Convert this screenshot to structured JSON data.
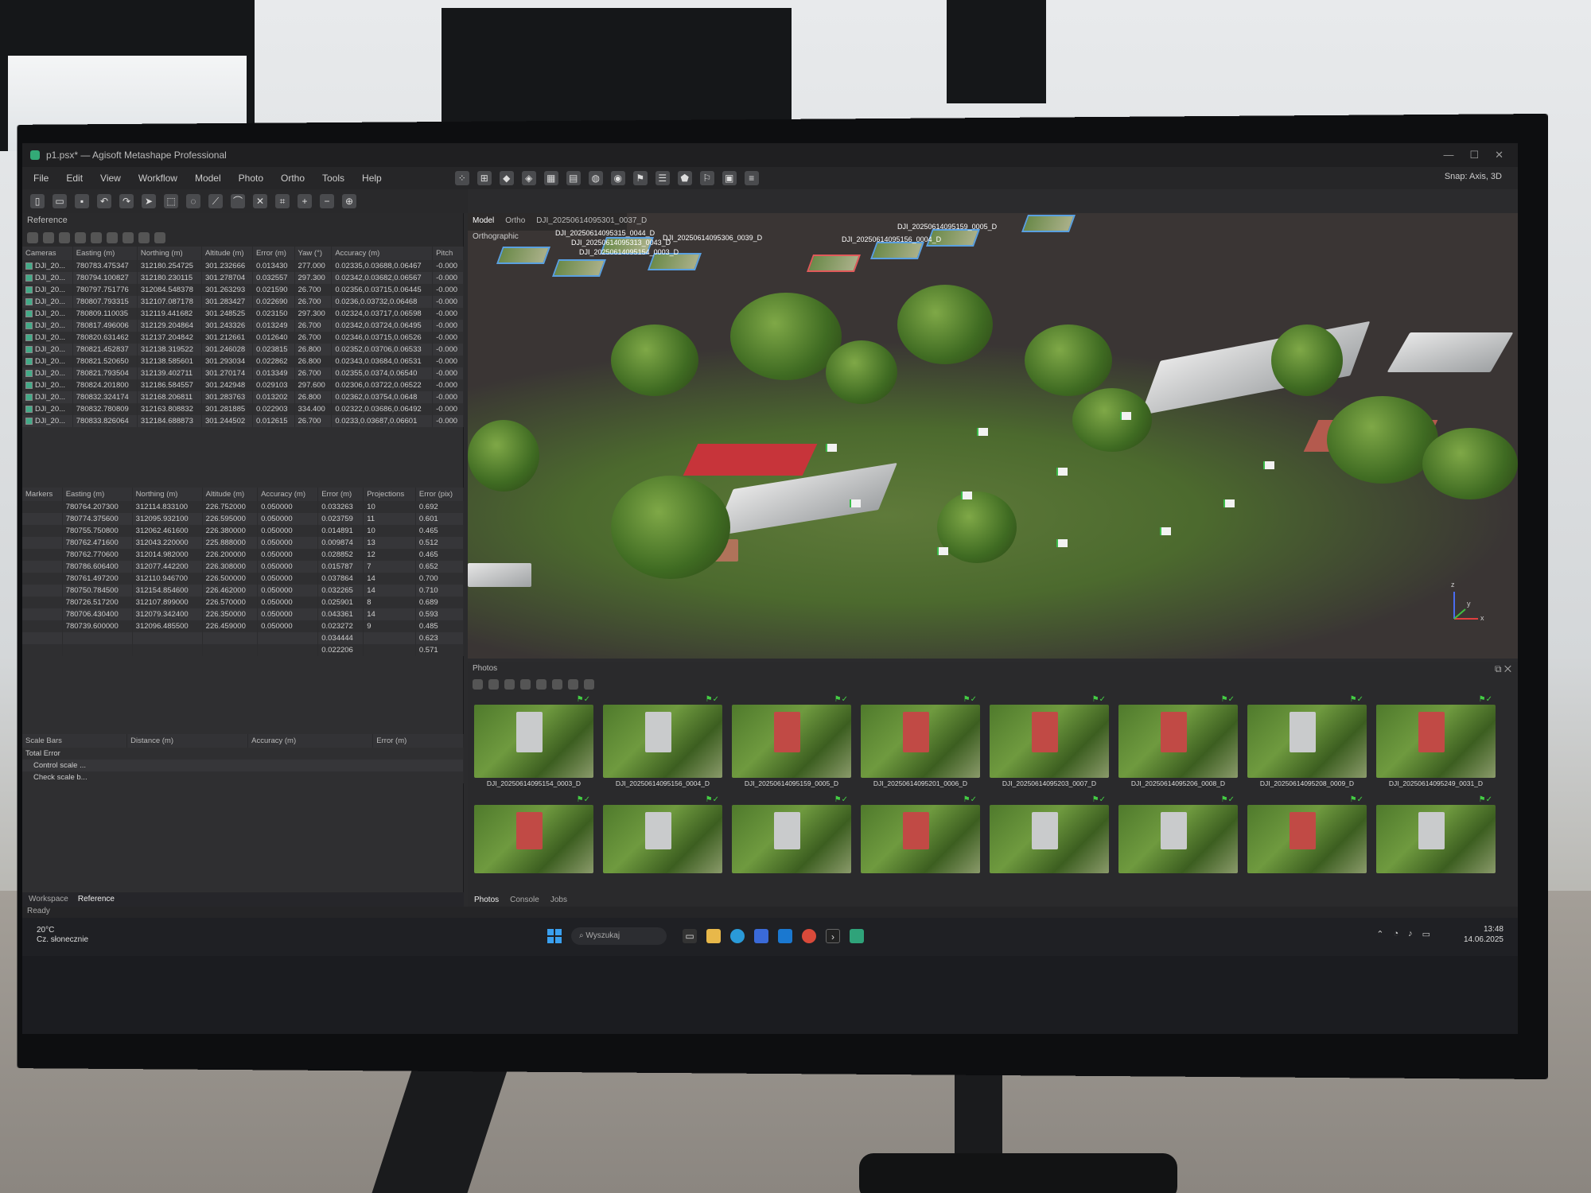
{
  "window": {
    "title": "p1.psx* — Agisoft Metashape Professional",
    "controls": [
      "—",
      "☐",
      "✕"
    ]
  },
  "menu": [
    "File",
    "Edit",
    "View",
    "Workflow",
    "Model",
    "Photo",
    "Ortho",
    "Tools",
    "Help"
  ],
  "viewport": {
    "snap": "Snap: Axis, 3D",
    "tabs": [
      "Model",
      "Ortho",
      "DJI_20250614095301_0037_D"
    ],
    "projection": "Orthographic",
    "camera_labels": [
      "DJI_20250614095159_0005_D",
      "DJI_20250614095315_0044_D",
      "DJI_20250614095313_0043_D",
      "DJI_20250614095306_0039_D",
      "DJI_20250614095156_0004_D",
      "DJI_20250614095154_0003_D"
    ],
    "axes": {
      "x": "x",
      "y": "y",
      "z": "z"
    }
  },
  "reference": {
    "panel_title": "Reference",
    "cameras_headers": [
      "Cameras",
      "Easting (m)",
      "Northing (m)",
      "Altitude (m)",
      "Error (m)",
      "Yaw (°)",
      "Accuracy (m)",
      "Pitch"
    ],
    "cameras": [
      [
        "DJI_20...",
        "780783.475347",
        "312180.254725",
        "301.232666",
        "0.013430",
        "277.000",
        "0.02335,0.03688,0.06467",
        "-0.000"
      ],
      [
        "DJI_20...",
        "780794.100827",
        "312180.230115",
        "301.278704",
        "0.032557",
        "297.300",
        "0.02342,0.03682,0.06567",
        "-0.000"
      ],
      [
        "DJI_20...",
        "780797.751776",
        "312084.548378",
        "301.263293",
        "0.021590",
        "26.700",
        "0.02356,0.03715,0.06445",
        "-0.000"
      ],
      [
        "DJI_20...",
        "780807.793315",
        "312107.087178",
        "301.283427",
        "0.022690",
        "26.700",
        "0.0236,0.03732,0.06468",
        "-0.000"
      ],
      [
        "DJI_20...",
        "780809.110035",
        "312119.441682",
        "301.248525",
        "0.023150",
        "297.300",
        "0.02324,0.03717,0.06598",
        "-0.000"
      ],
      [
        "DJI_20...",
        "780817.496006",
        "312129.204864",
        "301.243326",
        "0.013249",
        "26.700",
        "0.02342,0.03724,0.06495",
        "-0.000"
      ],
      [
        "DJI_20...",
        "780820.631462",
        "312137.204842",
        "301.212661",
        "0.012640",
        "26.700",
        "0.02346,0.03715,0.06526",
        "-0.000"
      ],
      [
        "DJI_20...",
        "780821.452837",
        "312138.319522",
        "301.246028",
        "0.023815",
        "26.800",
        "0.02352,0.03706,0.06533",
        "-0.000"
      ],
      [
        "DJI_20...",
        "780821.520650",
        "312138.585601",
        "301.293034",
        "0.022862",
        "26.800",
        "0.02343,0.03684,0.06531",
        "-0.000"
      ],
      [
        "DJI_20...",
        "780821.793504",
        "312139.402711",
        "301.270174",
        "0.013349",
        "26.700",
        "0.02355,0.0374,0.06540",
        "-0.000"
      ],
      [
        "DJI_20...",
        "780824.201800",
        "312186.584557",
        "301.242948",
        "0.029103",
        "297.600",
        "0.02306,0.03722,0.06522",
        "-0.000"
      ],
      [
        "DJI_20...",
        "780832.324174",
        "312168.206811",
        "301.283763",
        "0.013202",
        "26.800",
        "0.02362,0.03754,0.0648",
        "-0.000"
      ],
      [
        "DJI_20...",
        "780832.780809",
        "312163.808832",
        "301.281885",
        "0.022903",
        "334.400",
        "0.02322,0.03686,0.06492",
        "-0.000"
      ],
      [
        "DJI_20...",
        "780833.826064",
        "312184.688873",
        "301.244502",
        "0.012615",
        "26.700",
        "0.0233,0.03687,0.06601",
        "-0.000"
      ]
    ],
    "markers_headers": [
      "Markers",
      "Easting (m)",
      "Northing (m)",
      "Altitude (m)",
      "Accuracy (m)",
      "Error (m)",
      "Projections",
      "Error (pix)"
    ],
    "markers": [
      [
        "",
        "780764.207300",
        "312114.833100",
        "226.752000",
        "0.050000",
        "0.033263",
        "10",
        "0.692"
      ],
      [
        "",
        "780774.375600",
        "312095.932100",
        "226.595000",
        "0.050000",
        "0.023759",
        "11",
        "0.601"
      ],
      [
        "",
        "780755.750800",
        "312062.461600",
        "226.380000",
        "0.050000",
        "0.014891",
        "10",
        "0.465"
      ],
      [
        "",
        "780762.471600",
        "312043.220000",
        "225.888000",
        "0.050000",
        "0.009874",
        "13",
        "0.512"
      ],
      [
        "",
        "780762.770600",
        "312014.982000",
        "226.200000",
        "0.050000",
        "0.028852",
        "12",
        "0.465"
      ],
      [
        "",
        "780786.606400",
        "312077.442200",
        "226.308000",
        "0.050000",
        "0.015787",
        "7",
        "0.652"
      ],
      [
        "",
        "780761.497200",
        "312110.946700",
        "226.500000",
        "0.050000",
        "0.037864",
        "14",
        "0.700"
      ],
      [
        "",
        "780750.784500",
        "312154.854600",
        "226.462000",
        "0.050000",
        "0.032265",
        "14",
        "0.710"
      ],
      [
        "",
        "780726.517200",
        "312107.899000",
        "226.570000",
        "0.050000",
        "0.025901",
        "8",
        "0.689"
      ],
      [
        "",
        "780706.430400",
        "312079.342400",
        "226.350000",
        "0.050000",
        "0.043361",
        "14",
        "0.593"
      ],
      [
        "",
        "780739.600000",
        "312096.485500",
        "226.459000",
        "0.050000",
        "0.023272",
        "9",
        "0.485"
      ]
    ],
    "marker_totals": [
      [
        "",
        "",
        "",
        "",
        "",
        "0.034444",
        "",
        "0.623"
      ],
      [
        "",
        "",
        "",
        "",
        "",
        "0.022206",
        "",
        "0.571"
      ]
    ],
    "scalebar_headers": [
      "Scale Bars",
      "Distance (m)",
      "Accuracy (m)",
      "Error (m)"
    ],
    "scalebar_rows": [
      "Total Error",
      "Control scale ...",
      "Check scale b..."
    ],
    "bottom_tabs": [
      "Workspace",
      "Reference"
    ]
  },
  "status": "Ready",
  "photos": {
    "title": "Photos",
    "row1": [
      "DJI_20250614095154_0003_D",
      "DJI_20250614095156_0004_D",
      "DJI_20250614095159_0005_D",
      "DJI_20250614095201_0006_D",
      "DJI_20250614095203_0007_D",
      "DJI_20250614095206_0008_D",
      "DJI_20250614095208_0009_D",
      "DJI_20250614095249_0031_D"
    ],
    "row2_count": 8,
    "tabs": [
      "Photos",
      "Console",
      "Jobs"
    ]
  },
  "taskbar": {
    "weather_temp": "20°C",
    "weather_desc": "Cz. słonecznie",
    "search_placeholder": "Wyszukaj",
    "time": "13:48",
    "date": "14.06.2025"
  },
  "colors": {
    "accent_blue": "#3aa0f0",
    "court_red": "#c7343a",
    "panel_bg": "#2f2f31"
  }
}
